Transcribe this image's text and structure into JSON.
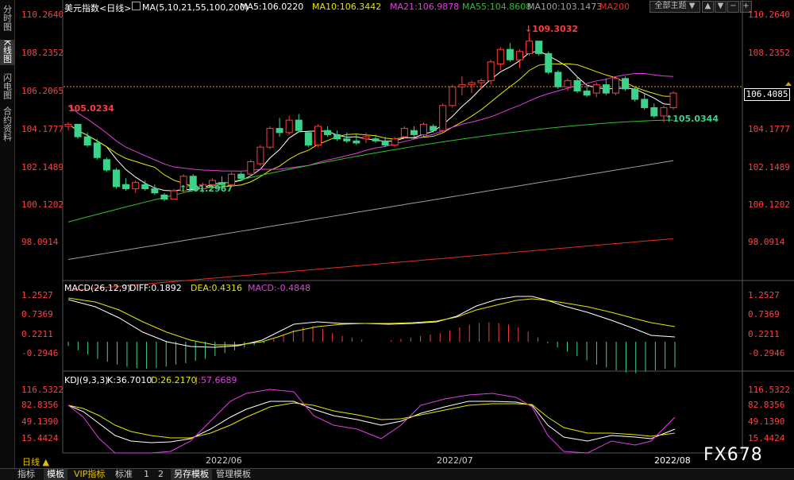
{
  "sidebar": {
    "tabs": [
      {
        "label": "分时图"
      },
      {
        "label": "K线图"
      },
      {
        "label": "闪电图"
      },
      {
        "label": "合约资料"
      }
    ]
  },
  "main_header": {
    "symbol": "美元指数<日线>",
    "ma_params": "MA(5,10,21,55,100,200)",
    "ma5": "MA5:106.0220",
    "ma10": "MA10:106.3442",
    "ma21": "MA21:106.9878",
    "ma55": "MA55:104.8608",
    "ma100": "MA100:103.1473",
    "ma200": "MA200",
    "theme_select": "全部主题",
    "nav_up": "▲",
    "nav_down": "▼",
    "nav_minus": "−",
    "nav_plus": "+"
  },
  "price_axis": [
    "110.2640",
    "108.2352",
    "106.2065",
    "104.1777",
    "102.1489",
    "100.1202",
    "98.0914"
  ],
  "current_price": "106.4085",
  "annotations": {
    "high": "109.3032",
    "low": "101.2967",
    "left_high": "105.0234",
    "last_low": "105.0344"
  },
  "macd": {
    "header": "MACD(26,12,9)",
    "diff": "DIFF:0.1892",
    "dea": "DEA:0.4316",
    "macd": "MACD:-0.4848",
    "axis": [
      "1.2527",
      "0.7369",
      "0.2211",
      "-0.2946"
    ]
  },
  "kdj": {
    "header": "KDJ(9,3,3)",
    "k": "K:36.7010",
    "d": "D:26.2170",
    "j": "J:57.6689",
    "axis": [
      "116.5322",
      "82.8356",
      "49.1390",
      "15.4424"
    ]
  },
  "dates": [
    "2022/06",
    "2022/07",
    "2022/08"
  ],
  "period_button": "日线 ▲",
  "bottom_tabs": [
    "指标",
    "模板",
    "VIP指标",
    "标准",
    "1",
    "2",
    "另存模板",
    "管理模板"
  ],
  "watermark": "FX678",
  "colors": {
    "up": "#ff3c3c",
    "down": "#3cd28c",
    "ma5": "#ffffff",
    "ma10": "#e6e600",
    "ma21": "#e040e0",
    "ma55": "#30c030",
    "ma100": "#a0a0a0",
    "ma200": "#e03020"
  },
  "chart_data": {
    "type": "candlestick",
    "series": [
      {
        "name": "K",
        "values": [
          {
            "o": 104.8,
            "h": 105.0,
            "l": 104.6,
            "c": 104.9
          },
          {
            "o": 104.9,
            "h": 104.9,
            "l": 104.2,
            "c": 104.3
          },
          {
            "o": 104.3,
            "h": 104.5,
            "l": 103.8,
            "c": 103.9
          },
          {
            "o": 104.0,
            "h": 104.2,
            "l": 103.2,
            "c": 103.3
          },
          {
            "o": 103.2,
            "h": 103.3,
            "l": 102.6,
            "c": 102.7
          },
          {
            "o": 102.7,
            "h": 102.8,
            "l": 101.8,
            "c": 101.9
          },
          {
            "o": 102.0,
            "h": 102.3,
            "l": 101.7,
            "c": 101.8
          },
          {
            "o": 101.8,
            "h": 102.2,
            "l": 101.6,
            "c": 102.1
          },
          {
            "o": 102.0,
            "h": 102.2,
            "l": 101.7,
            "c": 101.8
          },
          {
            "o": 101.8,
            "h": 102.0,
            "l": 101.5,
            "c": 101.6
          },
          {
            "o": 101.5,
            "h": 101.6,
            "l": 101.2,
            "c": 101.3
          },
          {
            "o": 101.3,
            "h": 101.8,
            "l": 101.3,
            "c": 101.7
          },
          {
            "o": 101.7,
            "h": 102.5,
            "l": 101.6,
            "c": 102.4
          },
          {
            "o": 102.4,
            "h": 102.5,
            "l": 101.7,
            "c": 101.8
          },
          {
            "o": 101.8,
            "h": 102.1,
            "l": 101.6,
            "c": 102.0
          },
          {
            "o": 102.0,
            "h": 102.3,
            "l": 101.9,
            "c": 102.2
          },
          {
            "o": 102.1,
            "h": 102.4,
            "l": 101.9,
            "c": 102.0
          },
          {
            "o": 102.0,
            "h": 102.6,
            "l": 101.9,
            "c": 102.5
          },
          {
            "o": 102.5,
            "h": 102.6,
            "l": 102.2,
            "c": 102.3
          },
          {
            "o": 102.5,
            "h": 103.2,
            "l": 102.4,
            "c": 103.1
          },
          {
            "o": 103.0,
            "h": 103.9,
            "l": 102.9,
            "c": 103.8
          },
          {
            "o": 103.8,
            "h": 104.8,
            "l": 103.7,
            "c": 104.7
          },
          {
            "o": 104.7,
            "h": 105.2,
            "l": 104.3,
            "c": 104.5
          },
          {
            "o": 104.5,
            "h": 105.3,
            "l": 104.4,
            "c": 105.1
          },
          {
            "o": 105.1,
            "h": 105.4,
            "l": 104.5,
            "c": 104.6
          },
          {
            "o": 104.5,
            "h": 104.6,
            "l": 103.8,
            "c": 103.9
          },
          {
            "o": 103.9,
            "h": 104.9,
            "l": 103.8,
            "c": 104.8
          },
          {
            "o": 104.6,
            "h": 104.8,
            "l": 104.3,
            "c": 104.4
          },
          {
            "o": 104.4,
            "h": 104.6,
            "l": 104.1,
            "c": 104.2
          },
          {
            "o": 104.2,
            "h": 104.5,
            "l": 104.0,
            "c": 104.1
          },
          {
            "o": 104.1,
            "h": 104.4,
            "l": 103.9,
            "c": 104.0
          },
          {
            "o": 104.2,
            "h": 104.5,
            "l": 104.0,
            "c": 104.3
          },
          {
            "o": 104.2,
            "h": 104.4,
            "l": 104.0,
            "c": 104.1
          },
          {
            "o": 104.1,
            "h": 104.3,
            "l": 103.8,
            "c": 103.9
          },
          {
            "o": 103.9,
            "h": 104.3,
            "l": 103.8,
            "c": 104.2
          },
          {
            "o": 104.3,
            "h": 104.8,
            "l": 104.2,
            "c": 104.7
          },
          {
            "o": 104.6,
            "h": 104.8,
            "l": 104.3,
            "c": 104.4
          },
          {
            "o": 104.4,
            "h": 105.0,
            "l": 104.3,
            "c": 104.9
          },
          {
            "o": 104.8,
            "h": 104.9,
            "l": 104.5,
            "c": 104.6
          },
          {
            "o": 104.6,
            "h": 105.9,
            "l": 104.5,
            "c": 105.8
          },
          {
            "o": 105.8,
            "h": 106.8,
            "l": 105.7,
            "c": 106.7
          },
          {
            "o": 106.7,
            "h": 107.2,
            "l": 106.3,
            "c": 106.8
          },
          {
            "o": 106.8,
            "h": 107.0,
            "l": 106.4,
            "c": 106.9
          },
          {
            "o": 106.9,
            "h": 107.1,
            "l": 106.6,
            "c": 107.0
          },
          {
            "o": 107.0,
            "h": 108.0,
            "l": 106.8,
            "c": 107.9
          },
          {
            "o": 107.8,
            "h": 108.6,
            "l": 107.5,
            "c": 108.5
          },
          {
            "o": 108.5,
            "h": 108.8,
            "l": 107.9,
            "c": 108.0
          },
          {
            "o": 108.0,
            "h": 108.5,
            "l": 107.6,
            "c": 108.4
          },
          {
            "o": 108.3,
            "h": 109.3,
            "l": 108.2,
            "c": 108.9
          },
          {
            "o": 108.9,
            "h": 108.9,
            "l": 108.2,
            "c": 108.3
          },
          {
            "o": 108.3,
            "h": 108.4,
            "l": 107.3,
            "c": 107.4
          },
          {
            "o": 107.4,
            "h": 107.5,
            "l": 106.6,
            "c": 106.7
          },
          {
            "o": 106.7,
            "h": 107.1,
            "l": 106.5,
            "c": 107.0
          },
          {
            "o": 107.0,
            "h": 107.2,
            "l": 106.4,
            "c": 106.5
          },
          {
            "o": 106.5,
            "h": 106.8,
            "l": 106.2,
            "c": 106.3
          },
          {
            "o": 106.4,
            "h": 106.9,
            "l": 106.2,
            "c": 106.8
          },
          {
            "o": 106.8,
            "h": 107.1,
            "l": 106.3,
            "c": 106.4
          },
          {
            "o": 106.4,
            "h": 107.2,
            "l": 106.3,
            "c": 107.1
          },
          {
            "o": 107.1,
            "h": 107.2,
            "l": 106.5,
            "c": 106.6
          },
          {
            "o": 106.6,
            "h": 106.7,
            "l": 106.0,
            "c": 106.1
          },
          {
            "o": 106.1,
            "h": 106.4,
            "l": 105.6,
            "c": 105.7
          },
          {
            "o": 105.7,
            "h": 105.9,
            "l": 105.2,
            "c": 105.3
          },
          {
            "o": 105.3,
            "h": 105.8,
            "l": 105.0,
            "c": 105.7
          },
          {
            "o": 105.7,
            "h": 106.5,
            "l": 105.6,
            "c": 106.4
          }
        ]
      }
    ],
    "x_labels": [
      "2022/06",
      "2022/07",
      "2022/08"
    ],
    "y_axis": [
      "110.2640",
      "108.2352",
      "106.2065",
      "104.1777",
      "102.1489",
      "100.1202",
      "98.0914"
    ],
    "ylim": [
      97.5,
      110.8
    ]
  }
}
